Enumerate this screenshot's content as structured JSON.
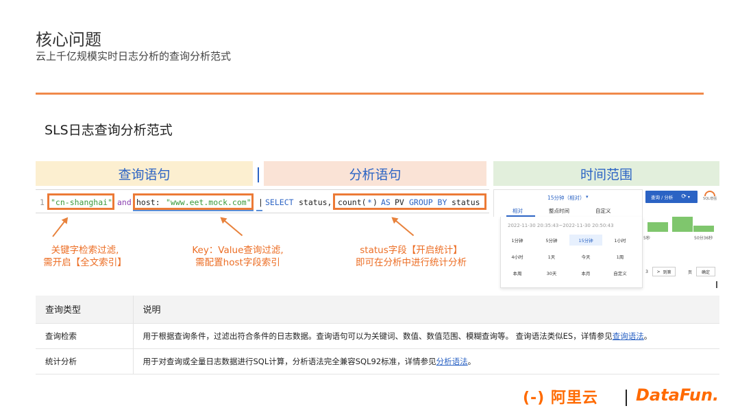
{
  "header": {
    "title": "核心问题",
    "subtitle": "云上千亿规模实时日志分析的查询分析范式"
  },
  "section": {
    "title": "SLS日志查询分析范式"
  },
  "bands": {
    "query": "查询语句",
    "divider": "|",
    "analysis": "分析语句",
    "time": "时间范围"
  },
  "code": {
    "line_no": "1",
    "keyword": "\"cn-shanghai\"",
    "and": "and",
    "kv_key": "host:",
    "kv_value": "\"www.eet.mock.com\"",
    "pipe": "|",
    "select": "SELECT",
    "status1": "status,",
    "count_fn": "count(",
    "star": "*",
    "close_paren": ")",
    "as": "AS",
    "pv": "PV",
    "group_by": "GROUP BY",
    "status2": "status"
  },
  "annotations": {
    "keyword_line1": "关键字检索过滤,",
    "keyword_line2": "需开启【全文索引】",
    "kv_line1": "Key：Value查询过滤,",
    "kv_line2": "需配置host字段索引",
    "stat_line1": "status字段【开启统计】",
    "stat_line2": "即可在分析中进行统计分析"
  },
  "time_picker": {
    "range_label": "15分钟（相对）",
    "tabs": [
      "相对",
      "整点时间",
      "自定义"
    ],
    "date_range": "2022-11-30 20:35:43~2022-11-30 20:50:43",
    "options": [
      [
        "1分钟",
        "5分钟",
        "15分钟",
        "1小时"
      ],
      [
        "4小时",
        "1天",
        "今天",
        "1周"
      ],
      [
        "本周",
        "30天",
        "本月",
        "自定义"
      ]
    ],
    "active_option": "15分钟",
    "query_button": "查询 / 分析",
    "refresh_icon": "refresh-icon",
    "gauge_label": "SQL增强",
    "axis_left": "5秒",
    "axis_right": "50分36秒",
    "pager": {
      "page_fragment": "3",
      "next": ">",
      "goto": "到第",
      "page_unit": "页",
      "confirm": "确定"
    }
  },
  "table": {
    "headers": [
      "查询类型",
      "说明"
    ],
    "rows": [
      {
        "type": "查询检索",
        "desc_text": "用于根据查询条件，过滤出符合条件的日志数据。查询语句可以为关键词、数值、数值范围、模糊查询等。 查询语法类似ES，详情参见",
        "link": "查询语法",
        "suffix": "。"
      },
      {
        "type": "统计分析",
        "desc_text": "用于对查询或全量日志数据进行SQL计算，分析语法完全兼容SQL92标准，详情参见",
        "link": "分析语法",
        "suffix": "。"
      }
    ]
  },
  "footer": {
    "logo_aliyun": "(-) 阿里云",
    "logo_datafun": "DataFun."
  },
  "colors": {
    "accent": "#f0894a",
    "link": "#2b63c4",
    "annotation": "#ec6e25",
    "band_query": "#fcefd0",
    "band_analysis": "#fae3d6",
    "band_time": "#e2efdc",
    "chart_bar": "#7fc66d"
  }
}
